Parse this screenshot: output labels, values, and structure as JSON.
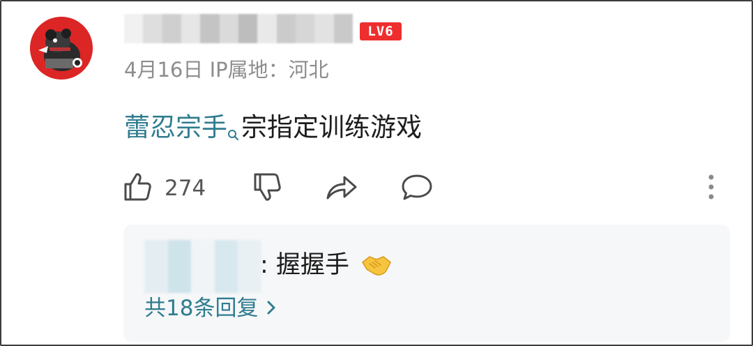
{
  "comment": {
    "level_badge": "LV6",
    "date_location": "4月16日 IP属地：河北",
    "link_text": "蕾忍宗手",
    "body_text": "宗指定训练游戏",
    "like_count": "274"
  },
  "reply_preview": {
    "separator": ":",
    "text": "握握手",
    "more_replies": "共18条回复"
  },
  "colors": {
    "link": "#2f7c8f",
    "badge": "#ee2e2e",
    "meta": "#8d8d8d",
    "icon": "#4a4a4a",
    "reply_bg": "#f6f7f9"
  },
  "icons": [
    "avatar",
    "search-icon",
    "thumbs-up-icon",
    "thumbs-down-icon",
    "share-icon",
    "comment-icon",
    "more-vertical-icon",
    "handshake-emoji-icon",
    "chevron-right-icon"
  ]
}
